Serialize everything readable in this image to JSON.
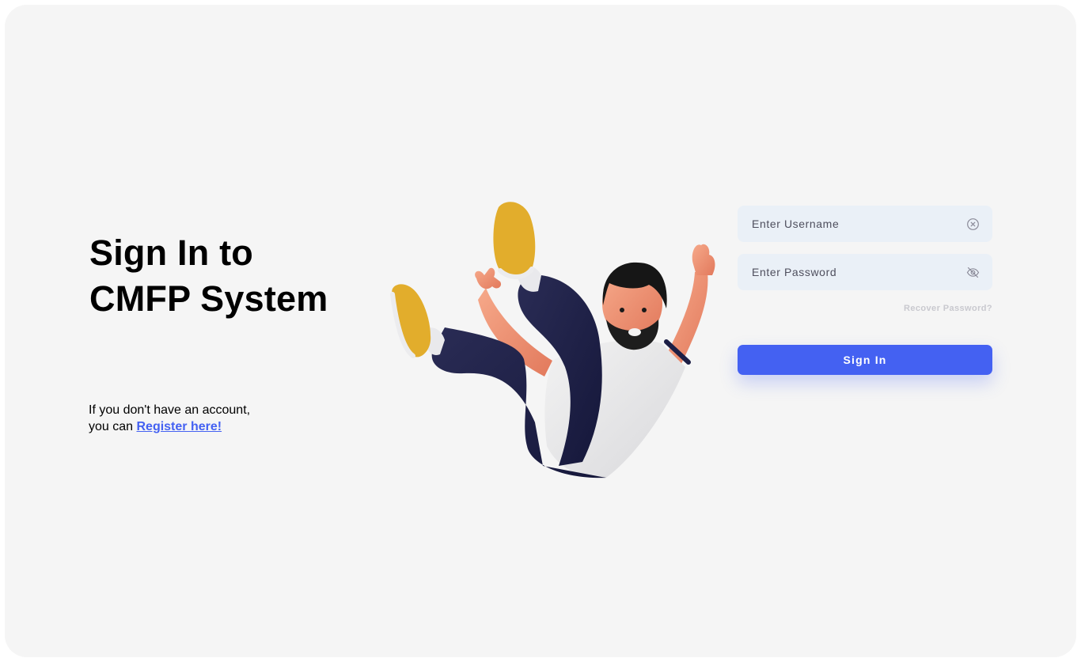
{
  "heading": {
    "line1": "Sign In to",
    "line2": "CMFP System"
  },
  "register": {
    "line1": "If you don't have an account,",
    "line2_prefix": "you can ",
    "link_label": "Register here!"
  },
  "form": {
    "username_placeholder": "Enter Username",
    "password_placeholder": "Enter Password",
    "username_icon": "clear-circle-icon",
    "password_icon": "eye-slash-icon",
    "recover_label": "Recover Password?",
    "submit_label": "Sign In"
  },
  "colors": {
    "accent": "#4461f2",
    "field_bg": "#eaf0f7",
    "page_bg": "#f5f5f5"
  }
}
